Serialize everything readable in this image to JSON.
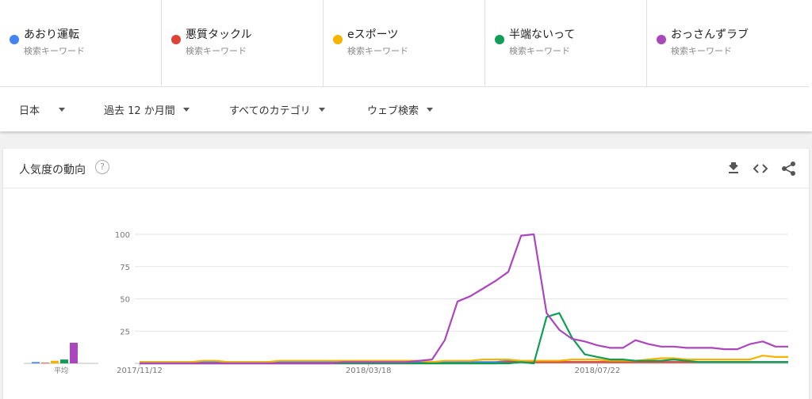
{
  "terms": [
    {
      "name": "あおり運転",
      "type": "検索キーワード",
      "color": "#4285f4"
    },
    {
      "name": "悪質タックル",
      "type": "検索キーワード",
      "color": "#db4437"
    },
    {
      "name": "eスポーツ",
      "type": "検索キーワード",
      "color": "#f4b400"
    },
    {
      "name": "半端ないって",
      "type": "検索キーワード",
      "color": "#0f9d58"
    },
    {
      "name": "おっさんずラブ",
      "type": "検索キーワード",
      "color": "#ab47bc"
    }
  ],
  "filters": {
    "region": "日本",
    "period": "過去 12 か月間",
    "category": "すべてのカテゴリ",
    "search_type": "ウェブ検索"
  },
  "card": {
    "title": "人気度の動向",
    "help_symbol": "?",
    "download_icon": "download-icon",
    "embed_icon": "embed-icon",
    "share_icon": "share-icon"
  },
  "chart_data": {
    "type": "line",
    "ylim": [
      0,
      100
    ],
    "yticks": [
      "100",
      "75",
      "50",
      "25"
    ],
    "xtick_labels": [
      "2017/11/12",
      "2018/03/18",
      "2018/07/22"
    ],
    "xtick_index": [
      0,
      18,
      36
    ],
    "grid": true,
    "average_label": "平均",
    "averages": [
      {
        "name": "あおり運転",
        "color": "#4285f4",
        "value": 1
      },
      {
        "name": "悪質タックル",
        "color": "#db4437",
        "value": 0
      },
      {
        "name": "eスポーツ",
        "color": "#f4b400",
        "value": 2
      },
      {
        "name": "半端ないって",
        "color": "#0f9d58",
        "value": 3
      },
      {
        "name": "おっさんずラブ",
        "color": "#ab47bc",
        "value": 16
      }
    ],
    "series": [
      {
        "name": "あおり運転",
        "color": "#4285f4",
        "values": [
          1,
          1,
          1,
          1,
          1,
          1,
          1,
          1,
          1,
          1,
          1,
          1,
          1,
          1,
          1,
          1,
          1,
          1,
          1,
          1,
          1,
          1,
          1,
          1,
          1,
          1,
          1,
          1,
          1,
          2,
          1,
          1,
          1,
          1,
          1,
          1,
          1,
          1,
          1,
          1,
          1,
          1,
          1,
          1,
          1,
          1,
          1,
          1,
          1,
          1,
          1,
          1
        ]
      },
      {
        "name": "悪質タックル",
        "color": "#db4437",
        "values": [
          0,
          0,
          0,
          0,
          0,
          0,
          0,
          0,
          0,
          0,
          0,
          0,
          0,
          0,
          0,
          0,
          0,
          0,
          0,
          0,
          0,
          0,
          0,
          0,
          0,
          0,
          0,
          0,
          0,
          1,
          1,
          1,
          1,
          1,
          1,
          1,
          1,
          1,
          1,
          1,
          1,
          1,
          1,
          1,
          1,
          1,
          1,
          1,
          1,
          1,
          1,
          1
        ]
      },
      {
        "name": "eスポーツ",
        "color": "#f4b400",
        "values": [
          1,
          1,
          1,
          1,
          1,
          2,
          2,
          1,
          1,
          1,
          1,
          2,
          2,
          2,
          2,
          2,
          2,
          2,
          2,
          2,
          2,
          2,
          2,
          1,
          2,
          2,
          2,
          3,
          3,
          3,
          2,
          2,
          2,
          2,
          3,
          3,
          3,
          2,
          2,
          2,
          3,
          4,
          4,
          3,
          3,
          3,
          3,
          3,
          3,
          6,
          5,
          5
        ]
      },
      {
        "name": "半端ないって",
        "color": "#0f9d58",
        "values": [
          0,
          0,
          0,
          0,
          0,
          0,
          0,
          0,
          0,
          0,
          0,
          0,
          0,
          0,
          0,
          0,
          0,
          0,
          0,
          0,
          0,
          0,
          0,
          0,
          0,
          0,
          0,
          0,
          0,
          0,
          1,
          0,
          36,
          39,
          20,
          7,
          5,
          3,
          3,
          2,
          2,
          2,
          3,
          2,
          1,
          1,
          1,
          1,
          1,
          1,
          1,
          1
        ]
      },
      {
        "name": "おっさんずラブ",
        "color": "#ab47bc",
        "values": [
          0,
          0,
          0,
          0,
          0,
          0,
          0,
          0,
          0,
          0,
          0,
          0,
          0,
          0,
          0,
          0,
          1,
          1,
          1,
          1,
          1,
          1,
          2,
          3,
          18,
          48,
          52,
          58,
          64,
          71,
          99,
          100,
          39,
          26,
          19,
          17,
          14,
          12,
          12,
          18,
          15,
          13,
          13,
          12,
          12,
          12,
          11,
          11,
          15,
          17,
          13,
          13
        ]
      }
    ]
  }
}
